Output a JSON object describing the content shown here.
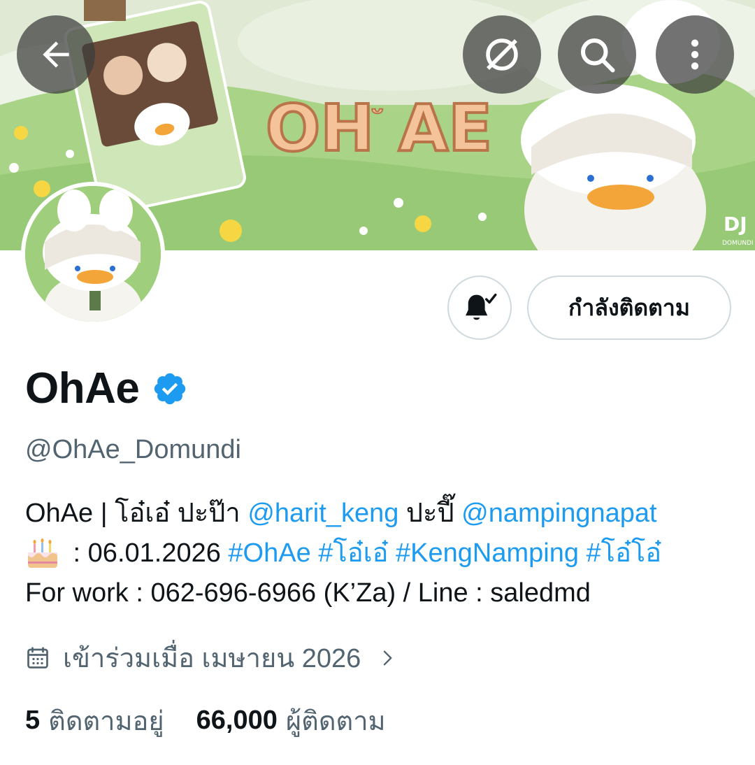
{
  "header": {
    "back_icon": "arrow-left-icon",
    "grok_icon": "slashed-circle-icon",
    "search_icon": "search-icon",
    "more_icon": "more-vertical-icon",
    "banner_logo_text": "OH AE",
    "banner_corner_text": "DOMUNDI"
  },
  "profile": {
    "bell_icon": "bell-check-icon",
    "follow_button_label": "กำลังติดตาม",
    "display_name": "OhAe",
    "verified_icon": "verified-badge-icon",
    "handle": "@OhAe_Domundi",
    "bio": {
      "line1_prefix": "OhAe | โอ๋เอ๋ ปะป๊า ",
      "line1_mention1": "@harit_keng",
      "line1_mid": " ปะปี๊ ",
      "line1_mention2": "@nampingnapat",
      "line2_date": " : 06.01.2026 ",
      "line2_tags": "#OhAe #โอ๋เอ๋ #KengNamping #โอ๋โอ๋",
      "line3": "For work : 062-696-6966 (K’Za) / Line : saledmd"
    },
    "joined_text": "เข้าร่วมเมื่อ เมษายน 2026",
    "following_count": "5",
    "following_label": "ติดตามอยู่",
    "followers_count": "66,000",
    "followers_label": "ผู้ติดตาม"
  },
  "colors": {
    "accent": "#1d9bf0",
    "secondary_text": "#536471",
    "border": "#cfd9de"
  }
}
